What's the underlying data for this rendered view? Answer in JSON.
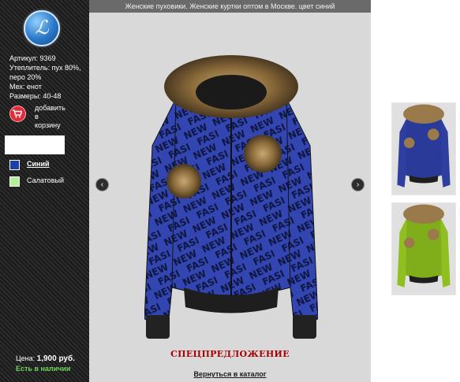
{
  "header": {
    "title": "Женские пуховики. Женские куртки оптом в Москве. цвет синий"
  },
  "product": {
    "specs": [
      "Артикул: 9369",
      "Утеплитель: пух 80%, перо 20%",
      "Мех: енот",
      "Размеры: 40-48"
    ],
    "cart_label_1": "добавить",
    "cart_label_2": "в",
    "cart_label_3": "корзину",
    "colors": [
      {
        "label": "Синий",
        "swatch": "#1c3fa8",
        "active": true
      },
      {
        "label": "Салатовый",
        "swatch": "#b6ef9c",
        "active": false
      }
    ],
    "price_label": "Цена:",
    "price_value": "1,900 руб.",
    "stock": "Есть в наличии"
  },
  "viewer": {
    "special_offer": "СПЕЦПРЕДЛОЖЕНИЕ",
    "back_link": "Вернуться в каталог",
    "icons": {
      "prev": "chevron-left-icon",
      "next": "chevron-right-icon",
      "cart": "shopping-cart-icon",
      "logo": "brand-logo"
    }
  },
  "colors": {
    "jacket_blue": "#2f3fa0",
    "jacket_print": "#0e1640",
    "fur": "#9a7a4a",
    "lime": "#8fbf20",
    "offer_red": "#a80000",
    "stock_green": "#6fd35a"
  }
}
